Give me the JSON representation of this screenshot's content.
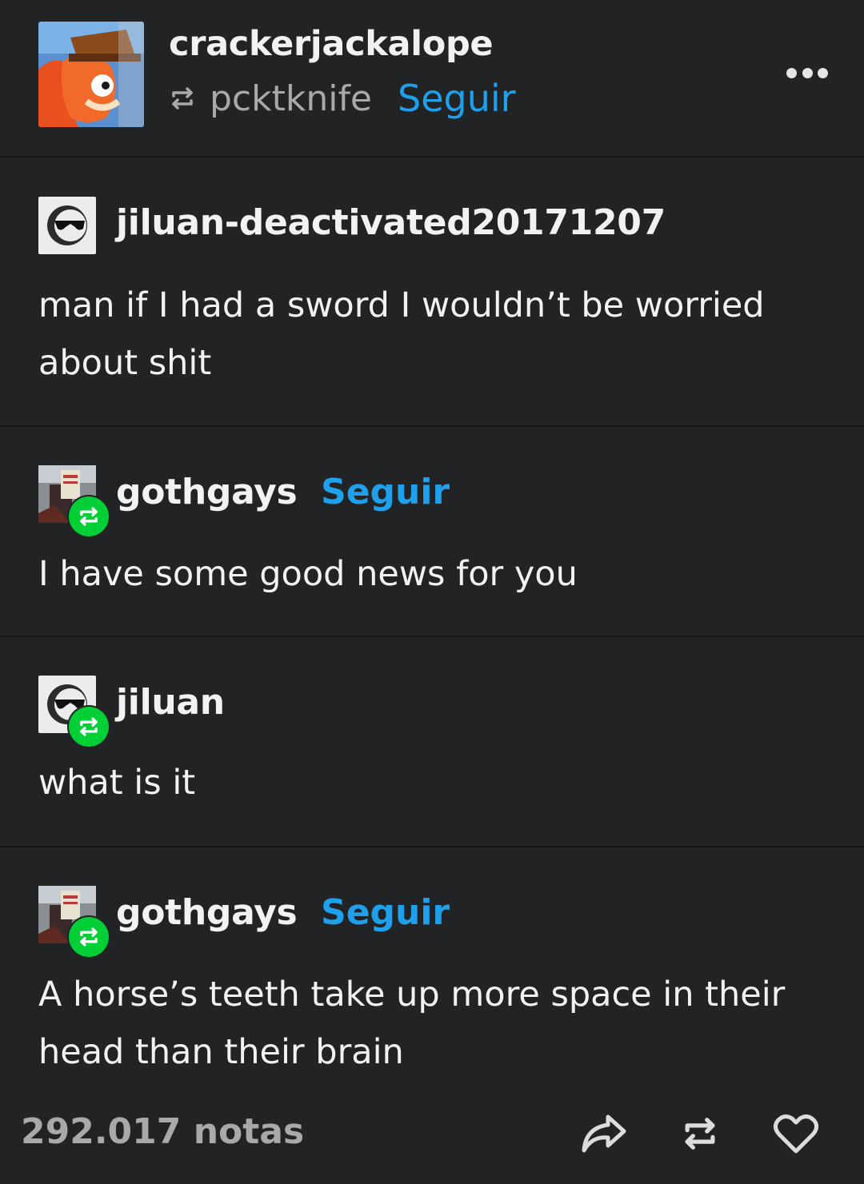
{
  "header": {
    "blog_name": "crackerjackalope",
    "reblogged_from": "pcktknife",
    "follow_label": "Seguir"
  },
  "entries": [
    {
      "username": "jiluan-deactivated20171207",
      "text": "man if I had a sword I wouldn’t be worried about shit",
      "follow_label": "",
      "reblog_badge": false
    },
    {
      "username": "gothgays",
      "text": "I have some good news for you",
      "follow_label": "Seguir",
      "reblog_badge": true
    },
    {
      "username": "jiluan",
      "text": "what is it",
      "follow_label": "",
      "reblog_badge": true
    },
    {
      "username": "gothgays",
      "text": "A horse’s teeth take up more space in their head than their brain",
      "follow_label": "Seguir",
      "reblog_badge": true
    }
  ],
  "footer": {
    "notes": "292.017 notas"
  },
  "colors": {
    "background": "#222324",
    "follow": "#1ea0ec",
    "reblog_badge": "#00cf35",
    "muted": "#a9a9a9"
  },
  "icons": [
    "reblog-icon",
    "more-options-icon",
    "share-icon",
    "reblog-button-icon",
    "like-heart-icon"
  ]
}
